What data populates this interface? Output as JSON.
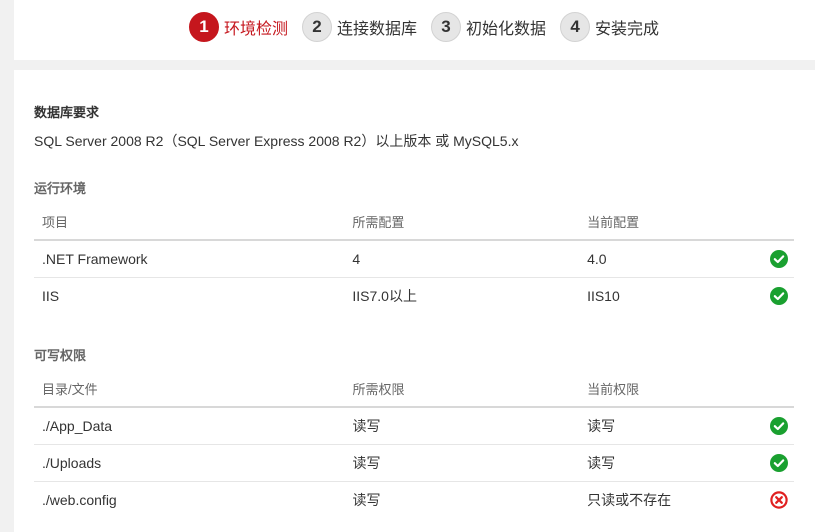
{
  "steps": [
    {
      "num": "1",
      "label": "环境检测",
      "active": true
    },
    {
      "num": "2",
      "label": "连接数据库",
      "active": false
    },
    {
      "num": "3",
      "label": "初始化数据",
      "active": false
    },
    {
      "num": "4",
      "label": "安装完成",
      "active": false
    }
  ],
  "db_requirement": {
    "title": "数据库要求",
    "text": "SQL Server 2008 R2（SQL Server Express 2008 R2）以上版本 或 MySQL5.x"
  },
  "runtime": {
    "title": "运行环境",
    "headers": [
      "项目",
      "所需配置",
      "当前配置"
    ],
    "rows": [
      {
        "item": ".NET Framework",
        "required": "4",
        "current": "4.0",
        "status": "ok"
      },
      {
        "item": "IIS",
        "required": "IIS7.0以上",
        "current": "IIS10",
        "status": "ok"
      }
    ]
  },
  "permissions": {
    "title": "可写权限",
    "headers": [
      "目录/文件",
      "所需权限",
      "当前权限"
    ],
    "rows": [
      {
        "item": "./App_Data",
        "required": "读写",
        "current": "读写",
        "status": "ok"
      },
      {
        "item": "./Uploads",
        "required": "读写",
        "current": "读写",
        "status": "ok"
      },
      {
        "item": "./web.config",
        "required": "读写",
        "current": "只读或不存在",
        "status": "error"
      }
    ]
  },
  "icons": {
    "ok": "check-circle-icon",
    "error": "error-circle-icon"
  },
  "colors": {
    "accent": "#c5161d",
    "ok": "#1aa030",
    "error": "#e02020"
  }
}
